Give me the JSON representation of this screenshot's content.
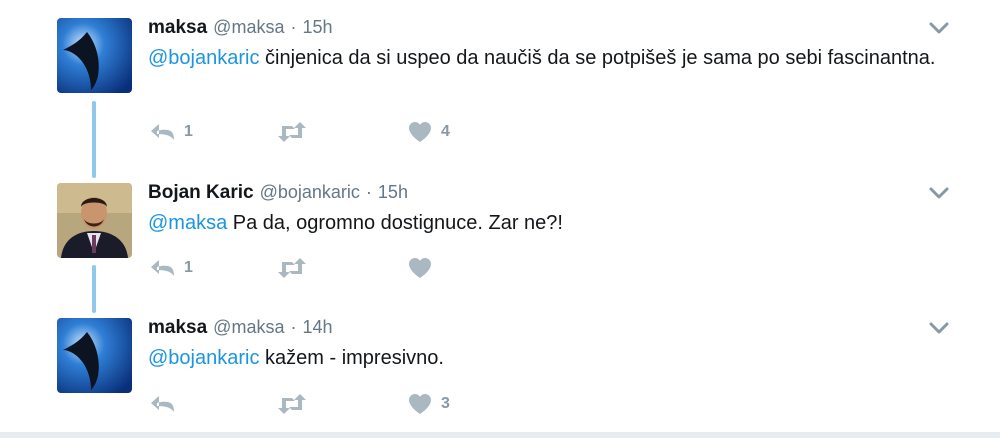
{
  "tweets": [
    {
      "name": "maksa",
      "handle": "@maksa",
      "dot": "·",
      "time": "15h",
      "mention": "@bojankaric",
      "text": " činjenica da si uspeo da naučiš da se potpišeš je sama po sebi fascinantna.",
      "reply_count": "1",
      "retweet_count": "",
      "like_count": "4"
    },
    {
      "name": "Bojan Karic",
      "handle": "@bojankaric",
      "dot": "·",
      "time": "15h",
      "mention": "@maksa",
      "text": " Pa da, ogromno dostignuce. Zar ne?!",
      "reply_count": "1",
      "retweet_count": "",
      "like_count": ""
    },
    {
      "name": "maksa",
      "handle": "@maksa",
      "dot": "·",
      "time": "14h",
      "mention": "@bojankaric",
      "text": " kažem - impresivno.",
      "reply_count": "",
      "retweet_count": "",
      "like_count": "3"
    }
  ],
  "icons": {
    "reply": "reply-icon",
    "retweet": "retweet-icon",
    "like": "heart-icon",
    "more": "chevron-down-icon"
  },
  "colors": {
    "mention": "#1b95e0",
    "meta": "#657786",
    "action": "#aab8c2",
    "connector": "#8fc8ec"
  }
}
